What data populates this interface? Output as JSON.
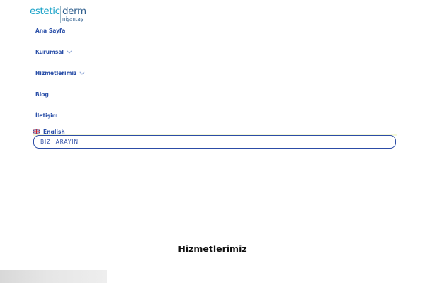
{
  "logo": {
    "brand_main": "estetic",
    "brand_secondary": "derm",
    "brand_sub": "nişantaşı"
  },
  "nav": {
    "items": [
      {
        "label": "Ana Sayfa",
        "has_dropdown": false
      },
      {
        "label": "Kurumsal",
        "has_dropdown": true
      },
      {
        "label": "Hizmetlerimiz",
        "has_dropdown": true
      },
      {
        "label": "Blog",
        "has_dropdown": false
      },
      {
        "label": "İletişim",
        "has_dropdown": false
      }
    ]
  },
  "language": {
    "label": "English",
    "flag_icon": "uk-flag-icon"
  },
  "call_button": {
    "label": "BIZI ARAYIN"
  },
  "services": {
    "title": "Hizmetlerimiz"
  },
  "colors": {
    "nav_text": "#2a4fa8",
    "accent": "#1ea4c9",
    "button_border": "#2c4ca6"
  }
}
